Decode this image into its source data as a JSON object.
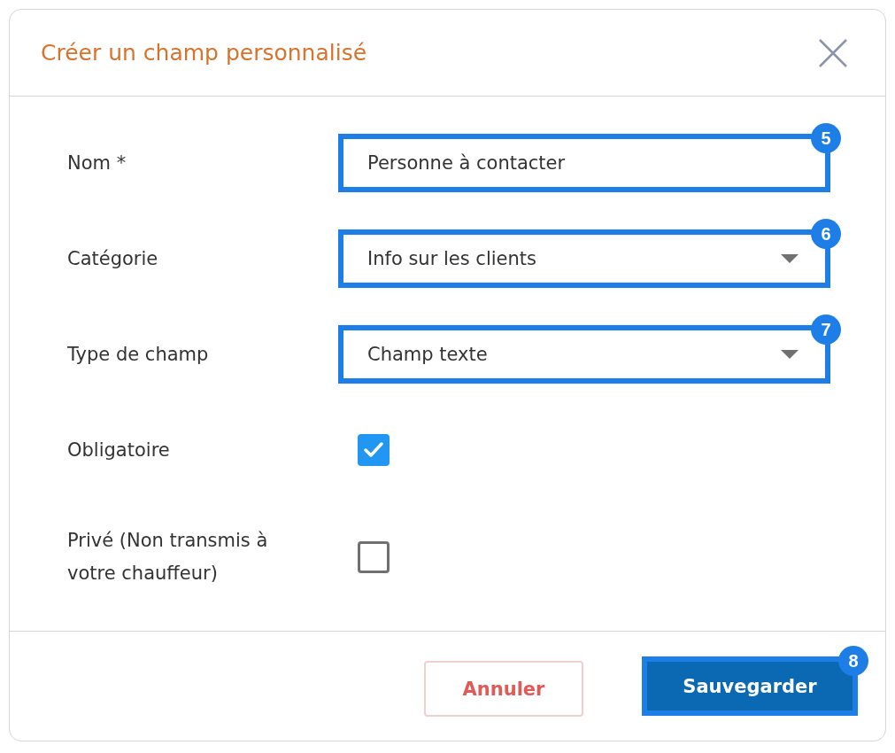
{
  "dialog": {
    "title": "Créer un champ personnalisé"
  },
  "fields": [
    {
      "kind": "text",
      "label": "Nom *",
      "value": "Personne à contacter",
      "marker": "5"
    },
    {
      "kind": "select",
      "label": "Catégorie",
      "value": "Info sur les clients",
      "marker": "6"
    },
    {
      "kind": "select",
      "label": "Type de champ",
      "value": "Champ texte",
      "marker": "7"
    },
    {
      "kind": "checkbox",
      "label": "Obligatoire",
      "checked": true
    },
    {
      "kind": "checkbox",
      "label": "Privé (Non transmis à votre chauffeur)",
      "checked": false
    }
  ],
  "buttons": [
    {
      "kind": "cancel",
      "label": "Annuler"
    },
    {
      "kind": "primary",
      "label": "Sauvegarder",
      "marker": "8"
    }
  ]
}
